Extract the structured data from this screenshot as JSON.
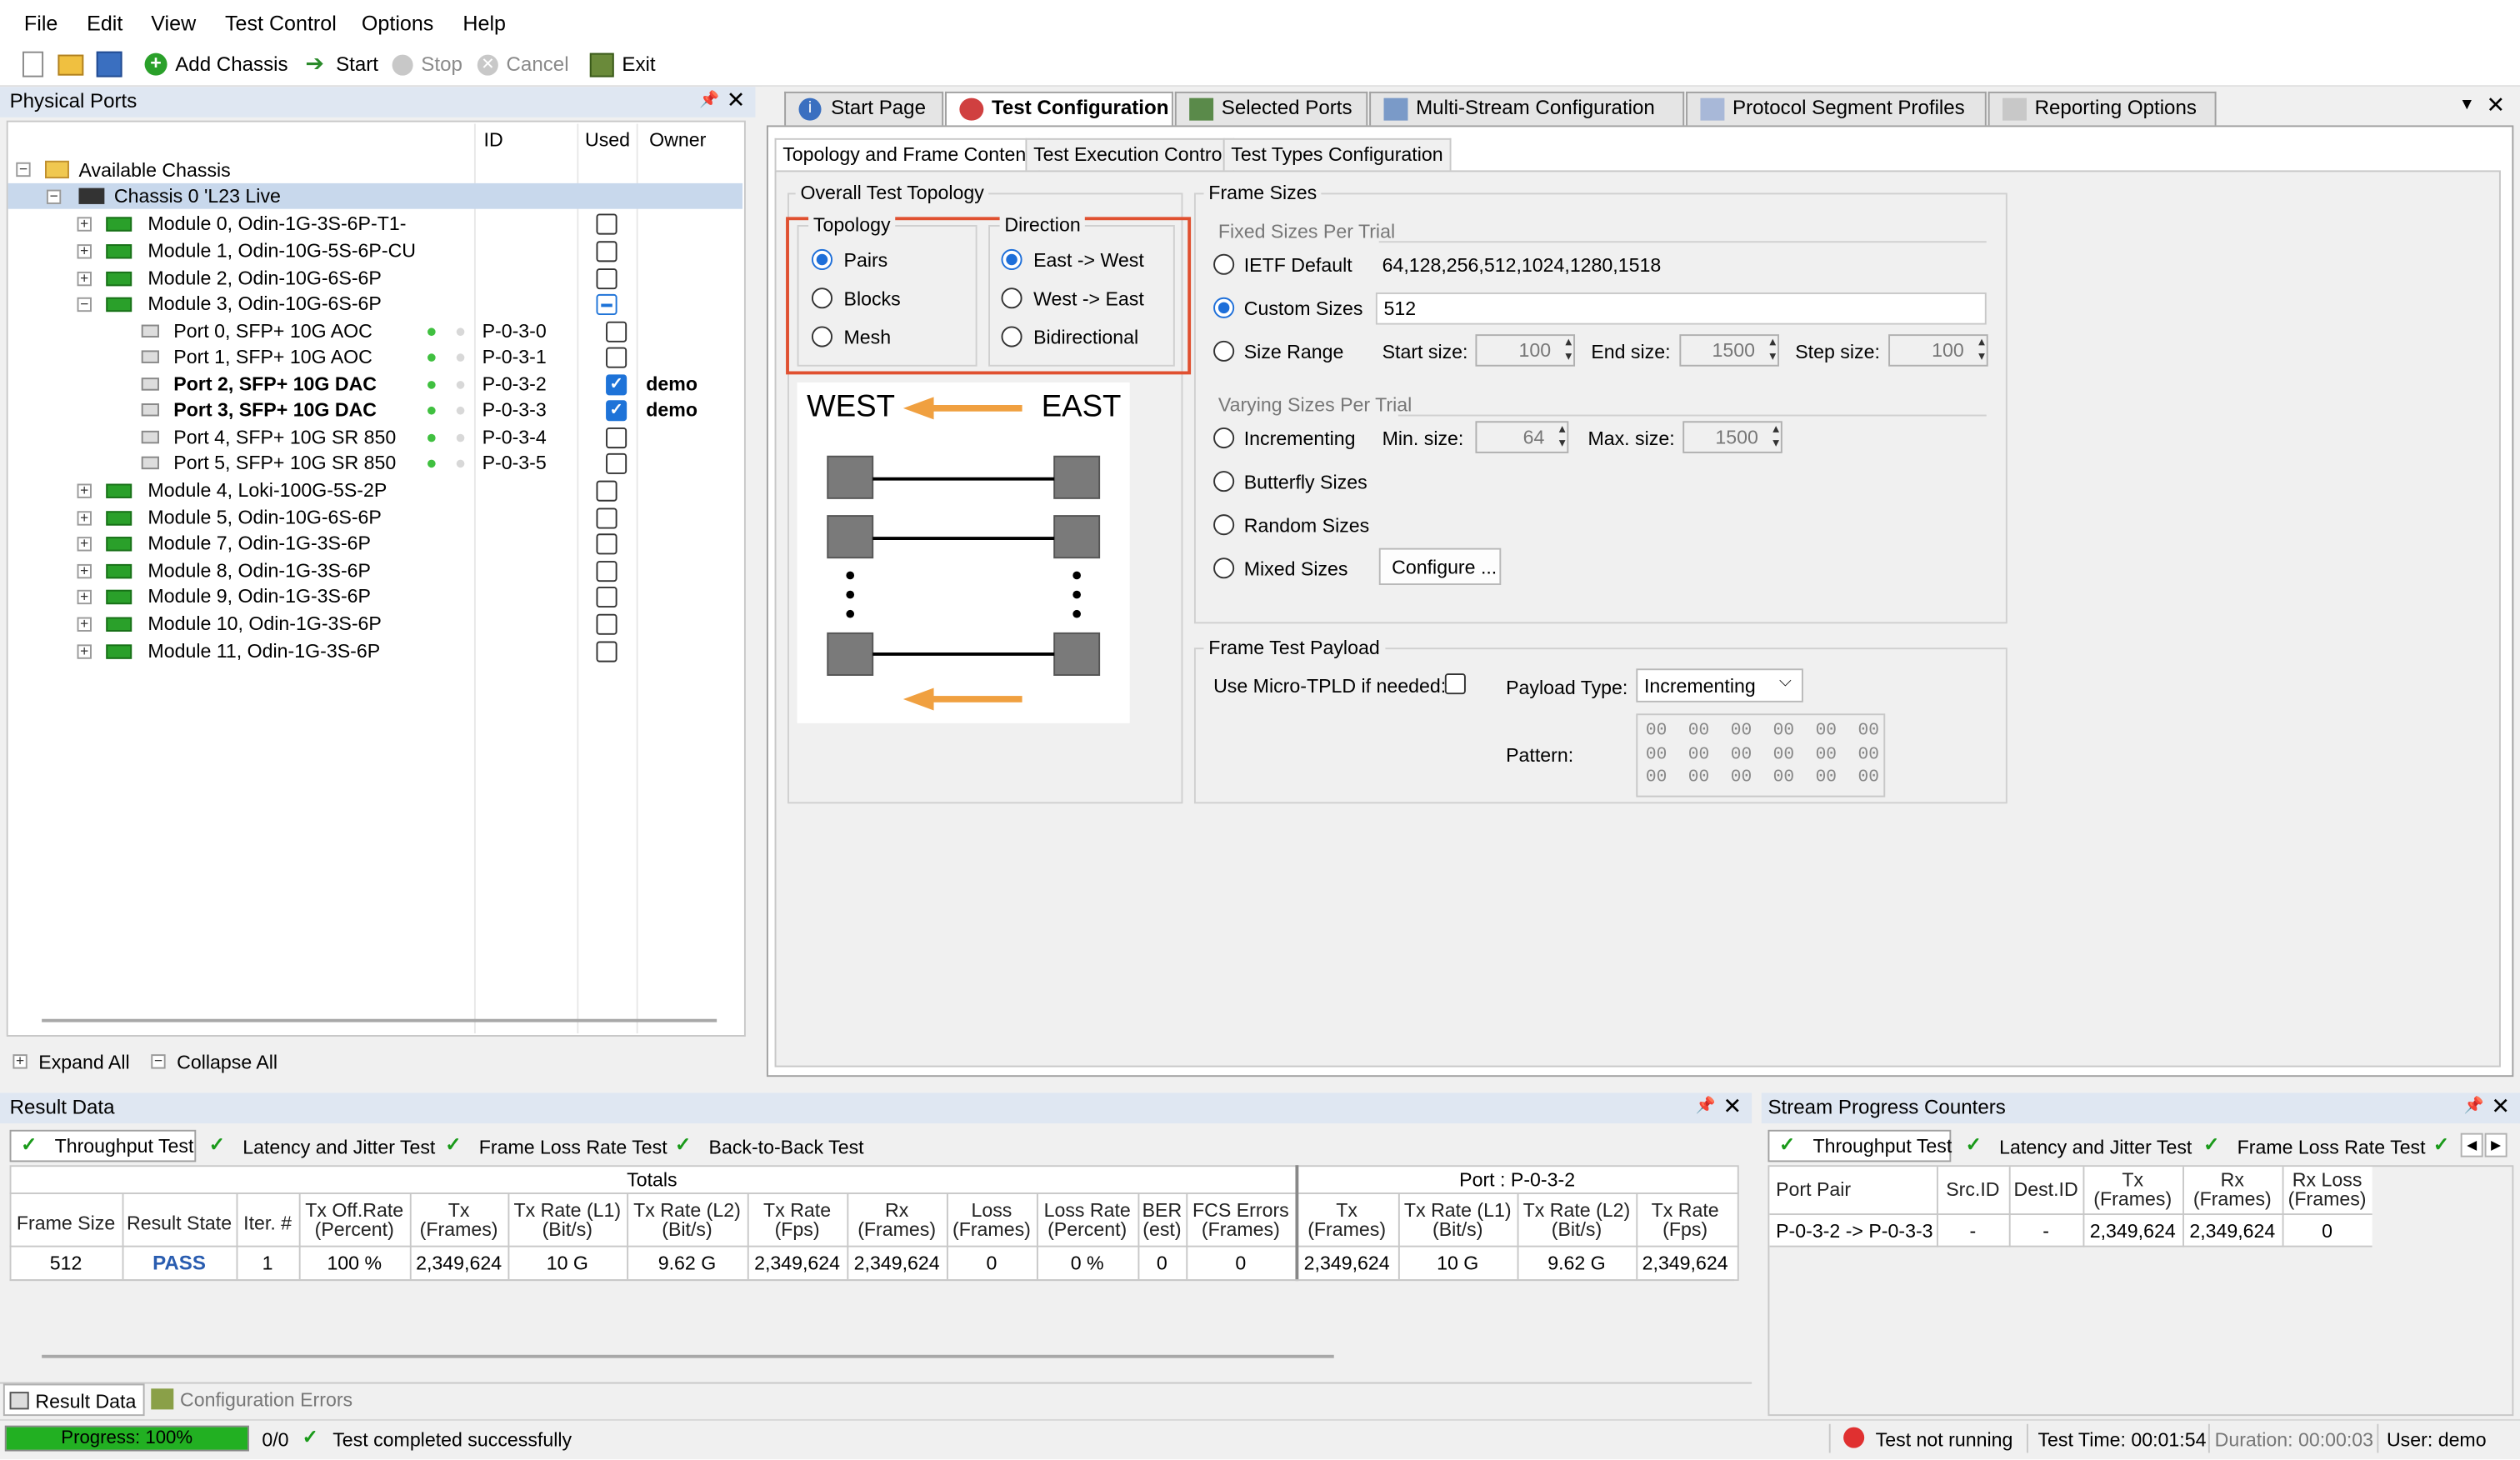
{
  "menu": [
    "File",
    "Edit",
    "View",
    "Test Control",
    "Options",
    "Help"
  ],
  "toolbar": {
    "add_chassis": "Add Chassis",
    "start": "Start",
    "stop": "Stop",
    "cancel": "Cancel",
    "exit": "Exit"
  },
  "ports_panel": {
    "title": "Physical Ports",
    "col_id": "ID",
    "col_used": "Used",
    "col_owner": "Owner",
    "root": "Available Chassis",
    "chassis": "Chassis 0 'L23 Live",
    "modules_top": [
      "Module 0, Odin-1G-3S-6P-T1-",
      "Module 1, Odin-10G-5S-6P-CU",
      "Module 2, Odin-10G-6S-6P",
      "Module 3, Odin-10G-6S-6P"
    ],
    "ports": [
      {
        "name": "Port 0, SFP+ 10G AOC",
        "id": "P-0-3-0",
        "used": false,
        "owner": ""
      },
      {
        "name": "Port 1, SFP+ 10G AOC",
        "id": "P-0-3-1",
        "used": false,
        "owner": ""
      },
      {
        "name": "Port 2, SFP+ 10G DAC",
        "id": "P-0-3-2",
        "used": true,
        "owner": "demo"
      },
      {
        "name": "Port 3, SFP+ 10G DAC",
        "id": "P-0-3-3",
        "used": true,
        "owner": "demo"
      },
      {
        "name": "Port 4, SFP+ 10G SR 850",
        "id": "P-0-3-4",
        "used": false,
        "owner": ""
      },
      {
        "name": "Port 5, SFP+ 10G SR 850",
        "id": "P-0-3-5",
        "used": false,
        "owner": ""
      }
    ],
    "modules_bottom": [
      "Module 4, Loki-100G-5S-2P",
      "Module 5, Odin-10G-6S-6P",
      "Module 7, Odin-1G-3S-6P",
      "Module 8, Odin-1G-3S-6P",
      "Module 9, Odin-1G-3S-6P",
      "Module 10, Odin-1G-3S-6P",
      "Module 11, Odin-1G-3S-6P"
    ],
    "expand_all": "Expand All",
    "collapse_all": "Collapse All"
  },
  "tabs": [
    "Start Page",
    "Test Configuration",
    "Selected Ports",
    "Multi-Stream Configuration",
    "Protocol Segment Profiles",
    "Reporting Options"
  ],
  "subtabs": [
    "Topology and Frame Content",
    "Test Execution Control",
    "Test Types Configuration"
  ],
  "topology": {
    "group": "Overall Test Topology",
    "topology_label": "Topology",
    "direction_label": "Direction",
    "topologies": [
      "Pairs",
      "Blocks",
      "Mesh"
    ],
    "selected_topology": "Pairs",
    "directions": [
      "East -> West",
      "West -> East",
      "Bidirectional"
    ],
    "selected_direction": "East -> West",
    "west": "WEST",
    "east": "EAST"
  },
  "frame_sizes": {
    "group": "Frame Sizes",
    "fixed_label": "Fixed Sizes Per Trial",
    "ietf": "IETF Default",
    "ietf_value": "64,128,256,512,1024,1280,1518",
    "custom": "Custom Sizes",
    "custom_value": "512",
    "range": "Size Range",
    "start_label": "Start size:",
    "start_value": "100",
    "end_label": "End size:",
    "end_value": "1500",
    "step_label": "Step size:",
    "step_value": "100",
    "varying_label": "Varying Sizes Per Trial",
    "incrementing": "Incrementing",
    "min_label": "Min. size:",
    "min_value": "64",
    "max_label": "Max. size:",
    "max_value": "1500",
    "butterfly": "Butterfly Sizes",
    "random": "Random Sizes",
    "mixed": "Mixed Sizes",
    "configure": "Configure ..."
  },
  "payload": {
    "group": "Frame Test Payload",
    "micro_tpld": "Use Micro-TPLD if needed:",
    "type_label": "Payload Type:",
    "type_value": "Incrementing",
    "pattern_label": "Pattern:",
    "pattern_rows": [
      "00  00  00  00  00  00",
      "00  00  00  00  00  00",
      "00  00  00  00  00  00"
    ]
  },
  "result_data": {
    "title": "Result Data",
    "tabs": [
      "Throughput Test",
      "Latency and Jitter Test",
      "Frame Loss Rate Test",
      "Back-to-Back Test"
    ],
    "group_totals": "Totals",
    "group_port": "Port : P-0-3-2",
    "columns": [
      "Frame Size",
      "Result State",
      "Iter. #",
      "Tx Off.Rate\n(Percent)",
      "Tx\n(Frames)",
      "Tx Rate (L1)\n(Bit/s)",
      "Tx Rate (L2)\n(Bit/s)",
      "Tx Rate\n(Fps)",
      "Rx\n(Frames)",
      "Loss\n(Frames)",
      "Loss Rate\n(Percent)",
      "BER\n(est)",
      "FCS Errors\n(Frames)",
      "Tx\n(Frames)",
      "Tx Rate (L1)\n(Bit/s)",
      "Tx Rate (L2)\n(Bit/s)",
      "Tx Rate\n(Fps)"
    ],
    "row": [
      "512",
      "PASS",
      "1",
      "100 %",
      "2,349,624",
      "10 G",
      "9.62 G",
      "2,349,624",
      "2,349,624",
      "0",
      "0 %",
      "0",
      "0",
      "2,349,624",
      "10 G",
      "9.62 G",
      "2,349,624"
    ],
    "bottom_tabs": [
      "Result Data",
      "Configuration Errors"
    ]
  },
  "stream": {
    "title": "Stream Progress Counters",
    "tabs": [
      "Throughput Test",
      "Latency and Jitter Test",
      "Frame Loss Rate Test"
    ],
    "columns": [
      "Port Pair",
      "Src.ID",
      "Dest.ID",
      "Tx\n(Frames)",
      "Rx\n(Frames)",
      "Rx Loss\n(Frames)"
    ],
    "row": [
      "P-0-3-2 -> P-0-3-3",
      "-",
      "-",
      "2,349,624",
      "2,349,624",
      "0"
    ]
  },
  "status": {
    "progress_label": "Progress: 100%",
    "progress": 1.0,
    "count": "0/0",
    "message": "Test completed successfully",
    "test_state": "Test not running",
    "test_time": "Test Time: 00:01:54",
    "duration": "Duration: 00:00:03",
    "user": "User: demo"
  },
  "colors": {
    "accent": "#1e73d8",
    "pass": "#2a5db0",
    "progress": "#22b022",
    "highlight": "#e05030",
    "arrow": "#f0a040"
  }
}
